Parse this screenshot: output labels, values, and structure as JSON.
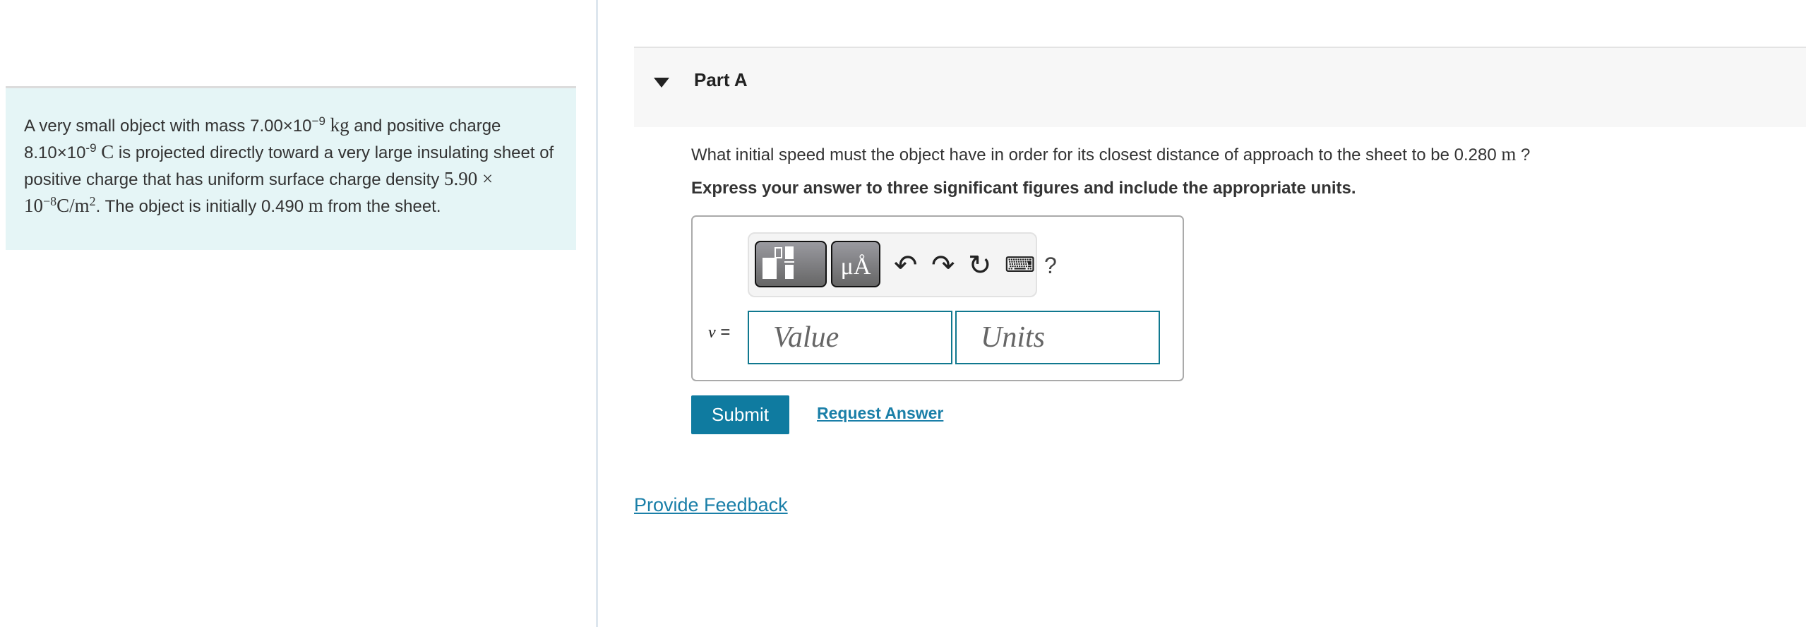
{
  "problem": {
    "t1": "A very small object with mass 7.00×10",
    "e1": "−9",
    "u1": "kg",
    "t2": " and positive charge",
    "t3": "8.10×10",
    "e2": "-9",
    "u2": "C",
    "t4": " is projected directly toward a very large insulating sheet of positive charge that has uniform surface charge density ",
    "m1": "5.90 × 10",
    "e3": "−8",
    "m2": "C/m",
    "e4": "2",
    "t5": ". The object is initially 0.490 ",
    "u3": "m",
    "t6": " from the sheet."
  },
  "part": {
    "title": "Part A"
  },
  "question": {
    "text": "What initial speed must the object have in order for its closest distance of approach to the sheet to be 0.280 ",
    "unit": "m",
    "end": " ?"
  },
  "instruction": "Express your answer to three significant figures and include the appropriate units.",
  "toolbar": {
    "units_label": "μÅ",
    "help": "?",
    "icons": [
      "templates-icon",
      "units-icon",
      "undo-icon",
      "redo-icon",
      "reset-icon",
      "keyboard-icon",
      "help-icon"
    ]
  },
  "answer": {
    "variable": "v",
    "equals": " =",
    "value_placeholder": "Value",
    "units_placeholder": "Units"
  },
  "buttons": {
    "submit": "Submit",
    "request": "Request Answer"
  },
  "feedback": "Provide Feedback",
  "colors": {
    "accent": "#0f7ba0",
    "problem_bg": "#e5f5f6",
    "link": "#1a7fa8"
  }
}
